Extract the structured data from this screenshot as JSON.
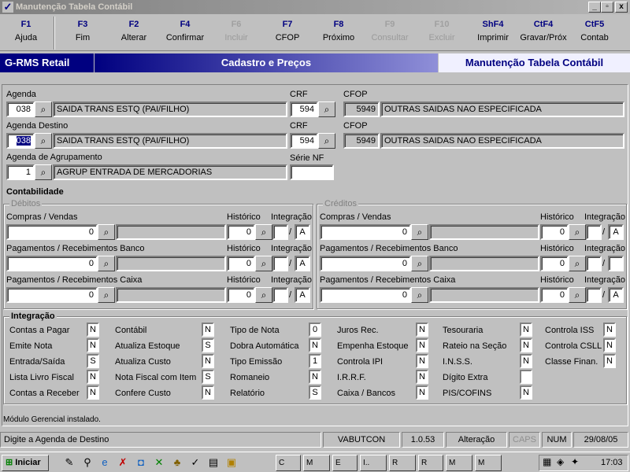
{
  "window": {
    "title": "Manutenção Tabela Contábil",
    "buttons": [
      "_",
      "▫",
      "x"
    ]
  },
  "toolbar": [
    {
      "key": "F1",
      "label": "Ajuda",
      "enabled": true
    },
    {
      "key": "F3",
      "label": "Fim",
      "enabled": true
    },
    {
      "key": "F2",
      "label": "Alterar",
      "enabled": true
    },
    {
      "key": "F4",
      "label": "Confirmar",
      "enabled": true
    },
    {
      "key": "F6",
      "label": "Incluir",
      "enabled": false
    },
    {
      "key": "F7",
      "label": "CFOP",
      "enabled": true
    },
    {
      "key": "F8",
      "label": "Próximo",
      "enabled": true
    },
    {
      "key": "F9",
      "label": "Consultar",
      "enabled": false
    },
    {
      "key": "F10",
      "label": "Excluir",
      "enabled": false
    },
    {
      "key": "ShF4",
      "label": "Imprimir",
      "enabled": true
    },
    {
      "key": "CtF4",
      "label": "Gravar/Próx",
      "enabled": true
    },
    {
      "key": "CtF5",
      "label": "Contab",
      "enabled": true
    }
  ],
  "header": {
    "app": "G-RMS Retail",
    "section": "Cadastro e Preços",
    "screen": "Manutenção Tabela Contábil"
  },
  "form": {
    "agenda": {
      "label": "Agenda",
      "code": "038",
      "desc": "SAIDA TRANS ESTQ (PAI/FILHO)",
      "crf_label": "CRF",
      "crf": "594",
      "cfop_label": "CFOP",
      "cfop": "5949",
      "cfop_desc": "OUTRAS SAIDAS NAO ESPECIFICADA"
    },
    "agenda_destino": {
      "label": "Agenda Destino",
      "code": "038",
      "desc": "SAIDA TRANS ESTQ (PAI/FILHO)",
      "crf_label": "CRF",
      "crf": "594",
      "cfop_label": "CFOP",
      "cfop": "5949",
      "cfop_desc": "OUTRAS SAIDAS NAO ESPECIFICADA"
    },
    "agenda_agrupamento": {
      "label": "Agenda de Agrupamento",
      "code": "1",
      "desc": "AGRUP ENTRADA DE MERCADORIAS",
      "serie_label": "Série NF",
      "serie": ""
    }
  },
  "contabilidade": {
    "title": "Contabilidade",
    "debitos": {
      "title": "Débitos",
      "rows": [
        {
          "label": "Compras / Vendas",
          "value": "0",
          "hist": "0",
          "integ_a": "",
          "integ_b": "A"
        },
        {
          "label": "Pagamentos / Recebimentos Banco",
          "value": "0",
          "hist": "0",
          "integ_a": "",
          "integ_b": "A"
        },
        {
          "label": "Pagamentos / Recebimentos Caixa",
          "value": "0",
          "hist": "0",
          "integ_a": "",
          "integ_b": "A"
        }
      ]
    },
    "creditos": {
      "title": "Créditos",
      "rows": [
        {
          "label": "Compras / Vendas",
          "value": "0",
          "hist": "0",
          "integ_a": "",
          "integ_b": "A"
        },
        {
          "label": "Pagamentos / Recebimentos Banco",
          "value": "0",
          "hist": "0",
          "integ_a": "",
          "integ_b": ""
        },
        {
          "label": "Pagamentos / Recebimentos Caixa",
          "value": "0",
          "hist": "0",
          "integ_a": "",
          "integ_b": "A"
        }
      ]
    },
    "hist_label": "Histórico",
    "integ_label": "Integração"
  },
  "integracao": {
    "title": "Integração",
    "columns": [
      [
        {
          "label": "Contas a Pagar",
          "value": "N"
        },
        {
          "label": "Emite Nota",
          "value": "N"
        },
        {
          "label": "Entrada/Saída",
          "value": "S"
        },
        {
          "label": "Lista Livro Fiscal",
          "value": "N"
        },
        {
          "label": "Contas a Receber",
          "value": "N"
        }
      ],
      [
        {
          "label": "Contábil",
          "value": "N"
        },
        {
          "label": "Atualiza Estoque",
          "value": "S"
        },
        {
          "label": "Atualiza Custo",
          "value": "N"
        },
        {
          "label": "Nota Fiscal com Item",
          "value": "S"
        },
        {
          "label": "Confere Custo",
          "value": "N"
        }
      ],
      [
        {
          "label": "Tipo de Nota",
          "value": "0"
        },
        {
          "label": "Dobra Automática",
          "value": "N"
        },
        {
          "label": "Tipo Emissão",
          "value": "1"
        },
        {
          "label": "Romaneio",
          "value": "N"
        },
        {
          "label": "Relatório",
          "value": "S"
        }
      ],
      [
        {
          "label": "Juros Rec.",
          "value": "N"
        },
        {
          "label": "Empenha Estoque",
          "value": "N"
        },
        {
          "label": "Controla IPI",
          "value": "N"
        },
        {
          "label": "I.R.R.F.",
          "value": "N"
        },
        {
          "label": "Caixa / Bancos",
          "value": "N"
        }
      ],
      [
        {
          "label": "Tesouraria",
          "value": "N"
        },
        {
          "label": "Rateio na Seção",
          "value": "N"
        },
        {
          "label": "I.N.S.S.",
          "value": "N"
        },
        {
          "label": "Dígito Extra",
          "value": ""
        },
        {
          "label": "PIS/COFINS",
          "value": "N"
        }
      ],
      [
        {
          "label": "Controla ISS",
          "value": "N"
        },
        {
          "label": "Controla CSLL",
          "value": "N"
        },
        {
          "label": "Classe Finan.",
          "value": "N"
        }
      ]
    ]
  },
  "module_msg": "Módulo Gerencial instalado.",
  "statusbar": {
    "hint": "Digite a Agenda de Destino",
    "user": "VABUTCON",
    "version": "1.0.53",
    "mode": "Alteração",
    "caps": "CAPS",
    "num": "NUM",
    "date": "29/08/05"
  },
  "taskbar": {
    "start": "Iniciar",
    "tasks": [
      "C",
      "M",
      "E",
      "I..",
      "R",
      "R",
      "M",
      "M"
    ],
    "clock": "17:03"
  },
  "icons": {
    "binoculars": "binoculars-icon",
    "app": "app-icon"
  }
}
